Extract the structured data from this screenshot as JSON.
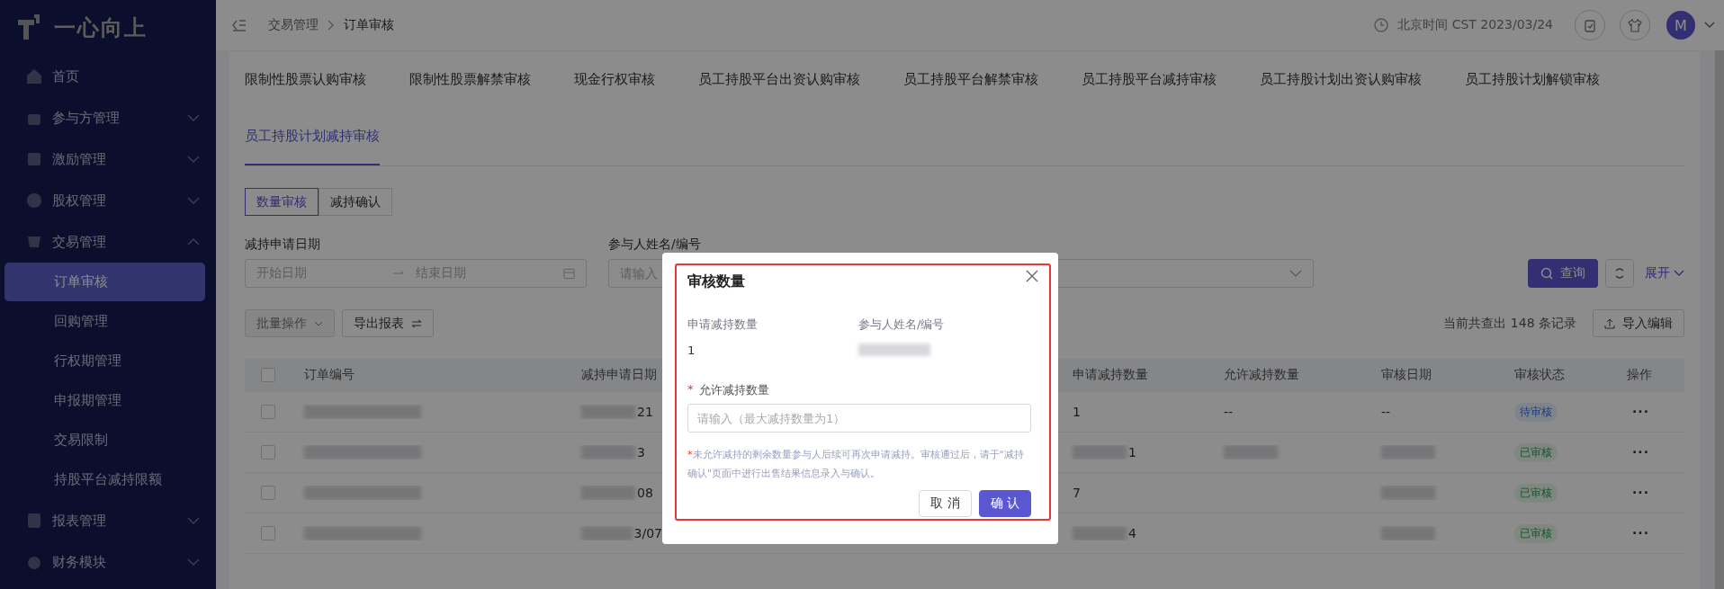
{
  "sidebar": {
    "logo": "一心向上",
    "items": [
      {
        "label": "首页"
      },
      {
        "label": "参与方管理",
        "expanded": false
      },
      {
        "label": "激励管理",
        "expanded": false
      },
      {
        "label": "股权管理",
        "expanded": false
      },
      {
        "label": "交易管理",
        "expanded": true,
        "children": [
          {
            "label": "订单审核",
            "selected": true
          },
          {
            "label": "回购管理",
            "selected": false
          },
          {
            "label": "行权期管理",
            "selected": false
          },
          {
            "label": "申报期管理",
            "selected": false
          },
          {
            "label": "交易限制",
            "selected": false
          },
          {
            "label": "持股平台减持限额",
            "selected": false
          }
        ]
      },
      {
        "label": "报表管理",
        "expanded": false
      },
      {
        "label": "财务模块",
        "expanded": false
      }
    ]
  },
  "header": {
    "breadcrumb": [
      "交易管理",
      "订单审核"
    ],
    "time": "北京时间 CST 2023/03/24",
    "avatar": "M"
  },
  "tabs": [
    {
      "label": "限制性股票认购审核",
      "selected": false
    },
    {
      "label": "限制性股票解禁审核",
      "selected": false
    },
    {
      "label": "现金行权审核",
      "selected": false
    },
    {
      "label": "员工持股平台出资认购审核",
      "selected": false
    },
    {
      "label": "员工持股平台解禁审核",
      "selected": false
    },
    {
      "label": "员工持股平台减持审核",
      "selected": false
    },
    {
      "label": "员工持股计划出资认购审核",
      "selected": false
    },
    {
      "label": "员工持股计划解锁审核",
      "selected": false
    },
    {
      "label": "员工持股计划减持审核",
      "selected": true
    }
  ],
  "segments": [
    {
      "label": "数量审核",
      "selected": true
    },
    {
      "label": "减持确认",
      "selected": false
    }
  ],
  "filters": [
    {
      "kind": "date_range",
      "label": "减持申请日期",
      "start_placeholder": "开始日期",
      "end_placeholder": "结束日期"
    },
    {
      "kind": "input",
      "label": "参与人姓名/编号",
      "placeholder": "请输入"
    },
    {
      "kind": "select"
    }
  ],
  "search_button": "查询",
  "expand_link": "展开",
  "toolbar": {
    "batch": {
      "label": "批量操作",
      "disabled": true
    },
    "export": "导出报表",
    "count": "当前共查出 148 条记录",
    "import": "导入编辑"
  },
  "table": {
    "header_checked": false,
    "columns": [
      "订单编号",
      "减持申请日期",
      "申请减持数量",
      "允许减持数量",
      "审核日期",
      "审核状态",
      "操作"
    ],
    "rows": [
      {
        "checked": false,
        "cells": [
          {
            "blurred": true
          },
          {
            "text": "21",
            "blurred": true
          },
          {
            "text": "1",
            "blurred": false
          },
          {
            "text": "--",
            "blurred": false
          },
          {
            "text": "--",
            "blurred": false
          }
        ],
        "status": {
          "text": "待审核",
          "kind": "pending"
        },
        "action": "···"
      },
      {
        "checked": false,
        "cells": [
          {
            "blurred": true
          },
          {
            "text": "3",
            "blurred": true
          },
          {
            "text": "1",
            "blurred": true
          },
          {
            "blurred": true
          },
          {
            "blurred": true
          }
        ],
        "status": {
          "text": "已审核",
          "kind": "approved"
        },
        "action": "···"
      },
      {
        "checked": false,
        "cells": [
          {
            "blurred": true
          },
          {
            "text": "08",
            "blurred": true
          },
          {
            "text": "7",
            "blurred": false
          },
          {
            "blurred": false
          },
          {
            "blurred": true
          }
        ],
        "status": {
          "text": "已审核",
          "kind": "approved"
        },
        "action": "···"
      },
      {
        "checked": false,
        "cells": [
          {
            "blurred": true
          },
          {
            "text": "3/07",
            "blurred": true
          },
          {
            "text": "4",
            "blurred": true
          },
          {
            "blurred": false
          },
          {
            "blurred": true
          }
        ],
        "status": {
          "text": "已审核",
          "kind": "approved"
        },
        "action": "···"
      }
    ]
  },
  "modal": {
    "title": "审核数量",
    "highlighted": true,
    "info": [
      {
        "label": "申请减持数量",
        "value": "1",
        "blurred": false
      },
      {
        "label": "参与人姓名/编号",
        "blurred": true
      }
    ],
    "field": {
      "required_mark": "*",
      "label": "允许减持数量",
      "placeholder": "请输入（最大减持数量为1）"
    },
    "note_mark": "*",
    "note": "未允许减持的剩余数量参与人后续可再次申请减持。审核通过后，请于\"减持确认\"页面中进行出售结果信息录入与确认。",
    "buttons": [
      {
        "label": "取 消",
        "kind": "default"
      },
      {
        "label": "确 认",
        "kind": "primary"
      }
    ]
  }
}
